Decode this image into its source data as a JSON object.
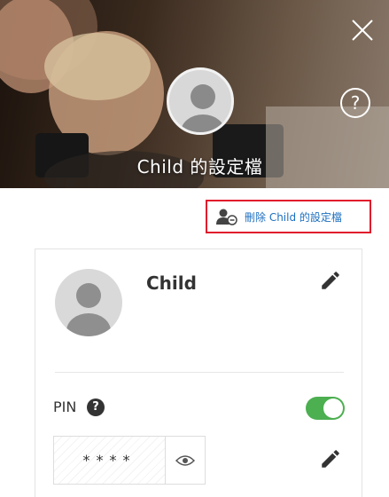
{
  "header": {
    "title": "Child 的設定檔",
    "help_glyph": "?"
  },
  "actions": {
    "delete_profile_label": "刪除 Child 的設定檔",
    "highlight_color": "#e0192c",
    "link_color": "#1c6fbf"
  },
  "profile": {
    "name": "Child"
  },
  "pin": {
    "label": "PIN",
    "help_glyph": "?",
    "enabled": true,
    "masked_value": "****",
    "toggle_color": "#4caf50"
  },
  "icons": {
    "close": "close-icon",
    "help": "help-icon",
    "delete_profile": "remove-user-icon",
    "edit": "pencil-icon",
    "show_pin": "eye-icon"
  }
}
